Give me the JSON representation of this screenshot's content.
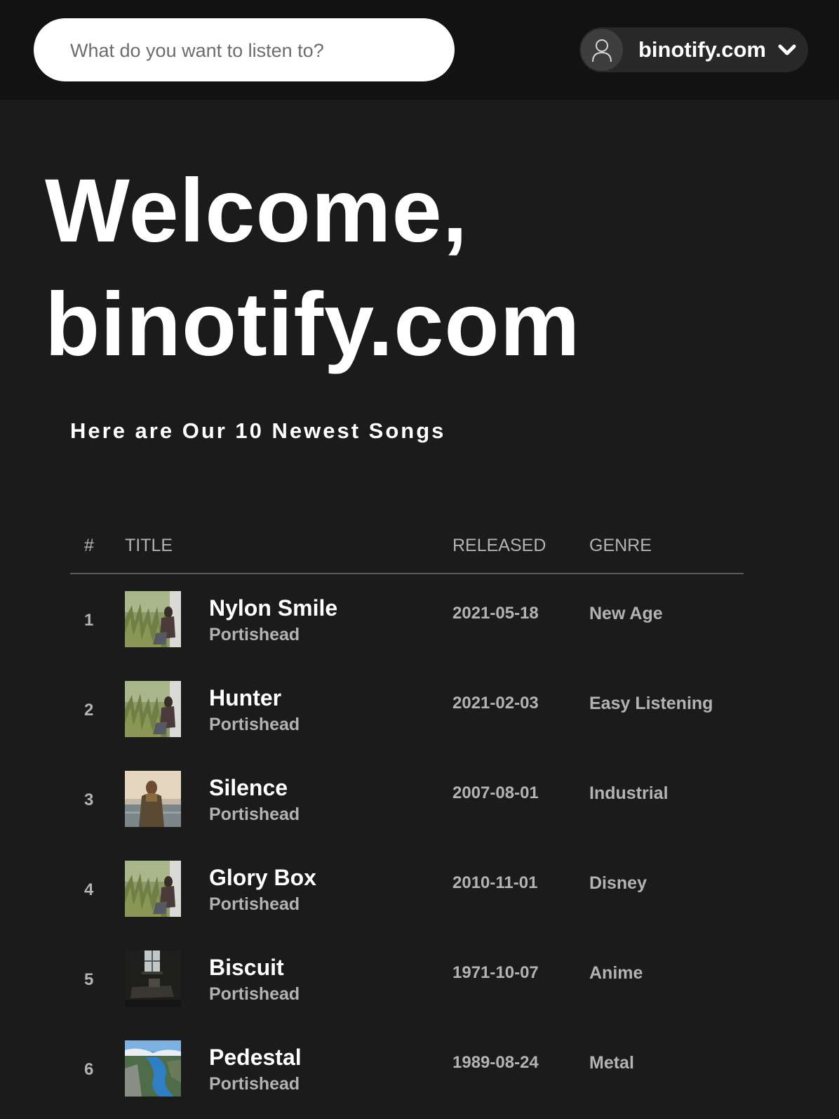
{
  "search": {
    "placeholder": "What do you want to listen to?"
  },
  "user_menu": {
    "name": "binotify.com",
    "avatar_icon": "user-icon",
    "dropdown_icon": "chevron-down-icon"
  },
  "welcome": {
    "line1": "Welcome,",
    "line2": "binotify.com"
  },
  "section_title": "Here are Our 10 Newest Songs",
  "table": {
    "columns": {
      "num": "#",
      "title": "TITLE",
      "released": "RELEASED",
      "genre": "GENRE"
    },
    "rows": [
      {
        "num": "1",
        "title": "Nylon Smile",
        "artist": "Portishead",
        "released": "2021-05-18",
        "genre": "New Age",
        "cover": "grass-field"
      },
      {
        "num": "2",
        "title": "Hunter",
        "artist": "Portishead",
        "released": "2021-02-03",
        "genre": "Easy Listening",
        "cover": "grass-field"
      },
      {
        "num": "3",
        "title": "Silence",
        "artist": "Portishead",
        "released": "2007-08-01",
        "genre": "Industrial",
        "cover": "person-by-sea"
      },
      {
        "num": "4",
        "title": "Glory Box",
        "artist": "Portishead",
        "released": "2010-11-01",
        "genre": "Disney",
        "cover": "grass-field"
      },
      {
        "num": "5",
        "title": "Biscuit",
        "artist": "Portishead",
        "released": "1971-10-07",
        "genre": "Anime",
        "cover": "dark-room"
      },
      {
        "num": "6",
        "title": "Pedestal",
        "artist": "Portishead",
        "released": "1989-08-24",
        "genre": "Metal",
        "cover": "fjord"
      }
    ]
  },
  "colors": {
    "background": "#1b1b1c",
    "topbar": "#121212",
    "muted_text": "#b3b3b3",
    "pill": "#282828"
  }
}
